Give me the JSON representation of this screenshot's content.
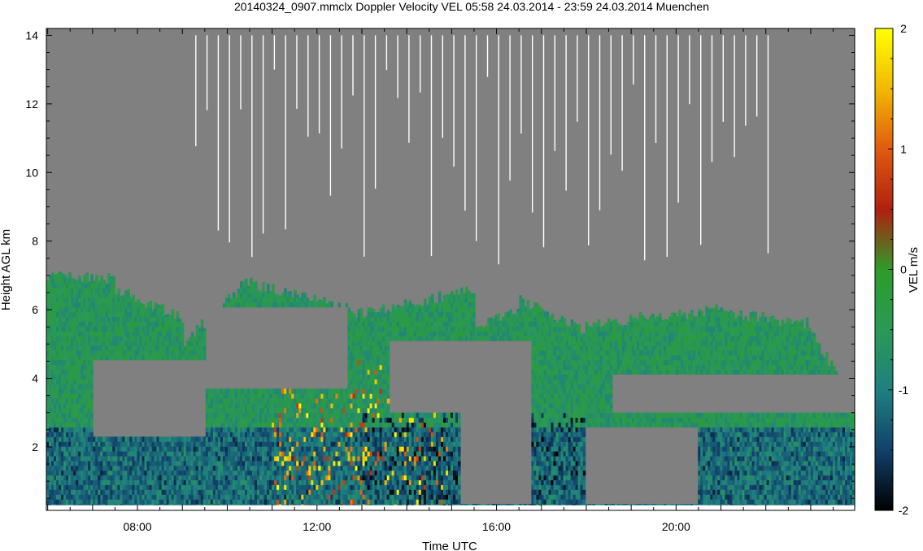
{
  "chart_data": {
    "type": "heatmap",
    "title": "20140324_0907.mmclx Doppler Velocity VEL   05:58 24.03.2014 - 23:59 24.03.2014 Muenchen",
    "xlabel": "Time UTC",
    "ylabel": "Height AGL km",
    "x_ticks": [
      "08:00",
      "12:00",
      "16:00",
      "20:00"
    ],
    "x_tick_hours": [
      8,
      12,
      16,
      20
    ],
    "y_ticks": [
      "2",
      "4",
      "6",
      "8",
      "10",
      "12",
      "14"
    ],
    "y_tick_values": [
      2,
      4,
      6,
      8,
      10,
      12,
      14
    ],
    "xlim_hours": [
      5.97,
      23.98
    ],
    "ylim_km": [
      0.15,
      14.2
    ],
    "background_color": "#808080",
    "colorbar": {
      "label": "VEL m/s",
      "ticks": [
        "2",
        "1",
        "0",
        "-1",
        "-2"
      ],
      "tick_values": [
        2,
        1,
        0,
        -1,
        -2
      ],
      "range": [
        -2,
        2
      ],
      "stops": [
        {
          "v": 2,
          "color": "#ffff00"
        },
        {
          "v": 1.5,
          "color": "#f2b800"
        },
        {
          "v": 1,
          "color": "#e05a10"
        },
        {
          "v": 0.5,
          "color": "#b02010"
        },
        {
          "v": 0,
          "color": "#2e9b2a"
        },
        {
          "v": -0.5,
          "color": "#2a9a55"
        },
        {
          "v": -1,
          "color": "#1f7f80"
        },
        {
          "v": -1.5,
          "color": "#12406b"
        },
        {
          "v": -2,
          "color": "#000000"
        }
      ]
    },
    "echo_regions": [
      {
        "t": [
          5.97,
          7.5
        ],
        "base_km": 0.2,
        "top_km": [
          7.0,
          6.9
        ]
      },
      {
        "t": [
          7.5,
          9.0
        ],
        "base_km": 0.2,
        "top_km": [
          6.6,
          5.8
        ]
      },
      {
        "t": [
          9.0,
          10.5
        ],
        "base_km": 0.2,
        "top_km": [
          5.0,
          6.9
        ]
      },
      {
        "t": [
          10.5,
          13.0
        ],
        "base_km": 0.2,
        "top_km": [
          6.8,
          5.9
        ]
      },
      {
        "t": [
          13.0,
          15.5
        ],
        "base_km": 0.2,
        "top_km": [
          5.9,
          6.6
        ]
      },
      {
        "t": [
          15.5,
          16.5
        ],
        "base_km": 0.2,
        "top_km": [
          5.5,
          6.1
        ]
      },
      {
        "t": [
          16.5,
          18.0
        ],
        "base_km": 0.2,
        "top_km": [
          6.3,
          5.4
        ]
      },
      {
        "t": [
          18.0,
          21.0
        ],
        "base_km": 0.2,
        "top_km": [
          5.6,
          6.0
        ]
      },
      {
        "t": [
          21.0,
          23.0
        ],
        "base_km": 0.2,
        "top_km": [
          5.9,
          5.6
        ]
      },
      {
        "t": [
          23.0,
          23.98
        ],
        "base_km": 0.2,
        "top_km": [
          5.4,
          3.2
        ]
      }
    ],
    "gaps": [
      {
        "t": [
          7.0,
          9.5
        ],
        "h": [
          2.3,
          4.5
        ]
      },
      {
        "t": [
          9.5,
          12.7
        ],
        "h": [
          3.6,
          6.0
        ]
      },
      {
        "t": [
          13.6,
          16.8
        ],
        "h": [
          3.0,
          5.0
        ]
      },
      {
        "t": [
          18.0,
          20.5
        ],
        "h": [
          0.3,
          2.5
        ]
      },
      {
        "t": [
          15.2,
          16.8
        ],
        "h": [
          0.3,
          3.0
        ]
      },
      {
        "t": [
          18.6,
          23.98
        ],
        "h": [
          3.0,
          4.0
        ]
      }
    ],
    "artifact_spikes_start_hour": 9.3,
    "artifact_spikes_end_hour": 22.1,
    "artifact_spikes_interval_hours": 0.25,
    "artifact_spike_min_km": 7.3,
    "artifact_spike_max_km": 13.2
  }
}
